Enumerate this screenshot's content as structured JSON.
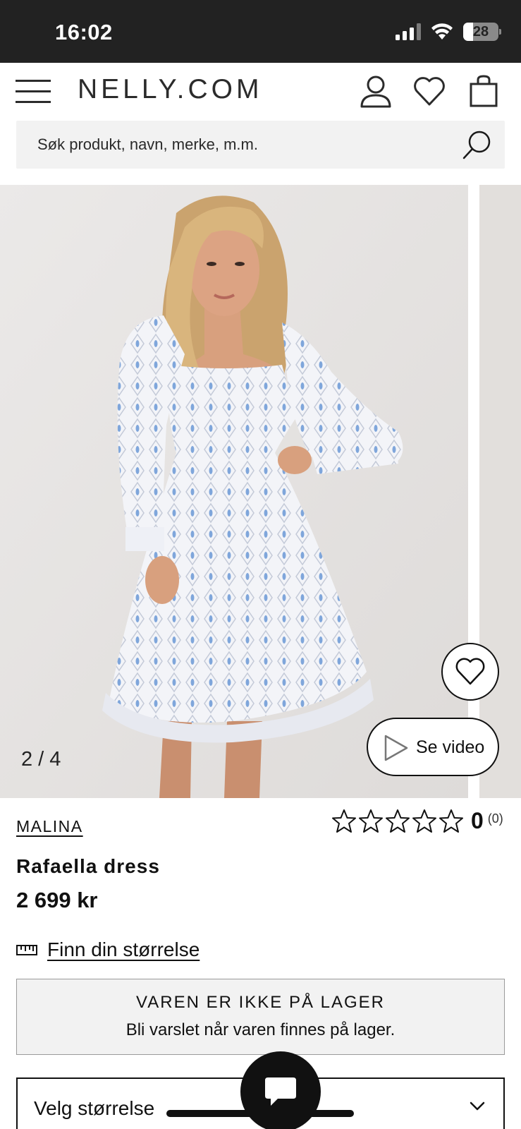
{
  "status_bar": {
    "time": "16:02",
    "battery_level": "28",
    "battery_fraction": 0.28,
    "icons": [
      "signal-icon",
      "wifi-icon",
      "battery-icon"
    ]
  },
  "header": {
    "logo": "NELLY.COM",
    "icons": [
      "menu-icon",
      "account-icon",
      "wishlist-icon",
      "bag-icon"
    ]
  },
  "search": {
    "placeholder": "Søk produkt, navn, merke, m.m.",
    "icon": "search-icon"
  },
  "gallery": {
    "counter": "2 / 4",
    "video_label": "Se video",
    "icons": [
      "heart-icon",
      "play-icon"
    ]
  },
  "product": {
    "brand": "MALINA",
    "name": "Rafaella dress",
    "price": "2 699 kr",
    "rating": {
      "score": "0",
      "count": "(0)",
      "stars_filled": 0,
      "stars_total": 5
    }
  },
  "size_guide": {
    "label": "Finn din størrelse",
    "icon": "ruler-icon"
  },
  "stock": {
    "title": "VAREN ER IKKE PÅ LAGER",
    "subtitle": "Bli varslet når varen finnes på lager."
  },
  "size_select": {
    "label": "Velg størrelse",
    "icon": "chevron-down-icon"
  },
  "chat": {
    "icon": "chat-icon"
  },
  "colors": {
    "status_bar": "#222222",
    "search_bg": "#f2f2f2",
    "photo_bg": "#e6e4e3",
    "dress_base": "#f3f4f8",
    "dress_pattern": "#7fa6db",
    "text": "#111111"
  }
}
